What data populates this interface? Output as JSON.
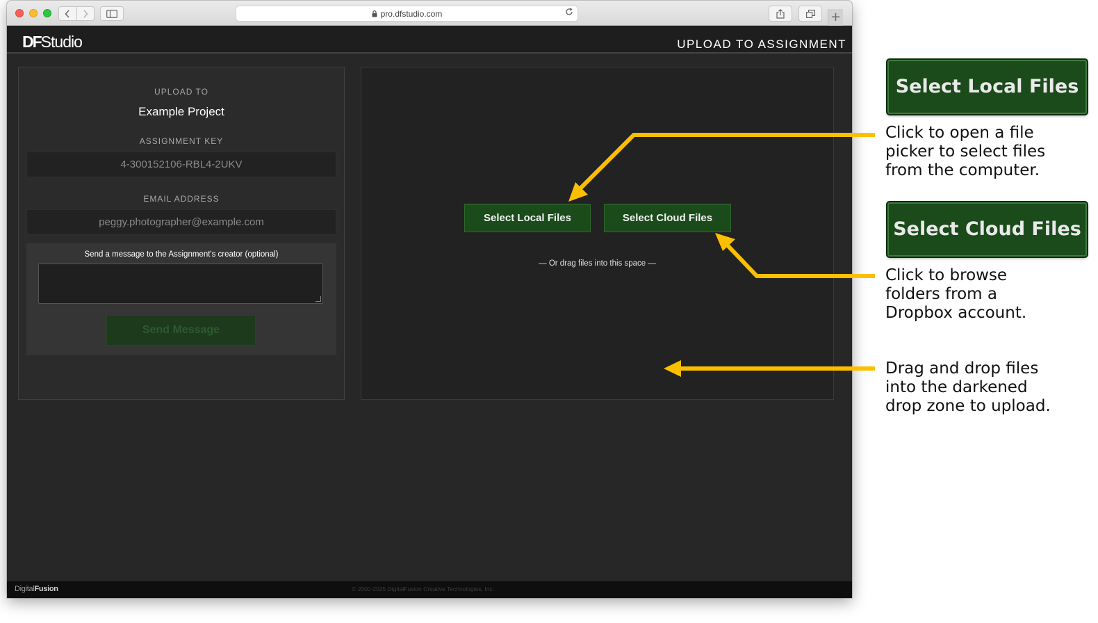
{
  "browser": {
    "url": "pro.dfstudio.com",
    "back_icon": "chevron-left-icon",
    "forward_icon": "chevron-right-icon",
    "new_tab_label": "+"
  },
  "app": {
    "logo_df": "DF",
    "logo_studio": "Studio",
    "heading": "UPLOAD TO ASSIGNMENT"
  },
  "upload_panel": {
    "upload_to_label": "UPLOAD TO",
    "project_name": "Example Project",
    "assignment_key_label": "ASSIGNMENT KEY",
    "assignment_key_value": "4-300152106-RBL4-2UKV",
    "email_label": "EMAIL ADDRESS",
    "email_value": "peggy.photographer@example.com",
    "message_label": "Send a message to the Assignment's creator (optional)",
    "message_value": "",
    "send_button_label": "Send Message"
  },
  "drop_zone": {
    "select_local_label": "Select Local Files",
    "select_cloud_label": "Select Cloud Files",
    "drag_hint": "—  Or drag files into this space  —"
  },
  "footer": {
    "brand_light": "Digital",
    "brand_bold": "Fusion",
    "copyright": "© 2000-2025 DigitalFusion Creative Technologies, Inc."
  },
  "annotations": {
    "local_button_label": "Select Local Files",
    "local_note_lines": [
      "Click to open a file",
      "picker to select files",
      "from the computer."
    ],
    "cloud_button_label": "Select Cloud Files",
    "cloud_note_lines": [
      "Click to browse",
      "folders from a",
      "Dropbox account."
    ],
    "drop_note_lines": [
      "Drag and drop files",
      "into the darkened",
      "drop zone to upload."
    ],
    "arrow_color": "#fbbf00"
  },
  "colors": {
    "button_green": "#1b4a1b",
    "page_background": "#272727",
    "drop_zone_background": "#222222"
  }
}
